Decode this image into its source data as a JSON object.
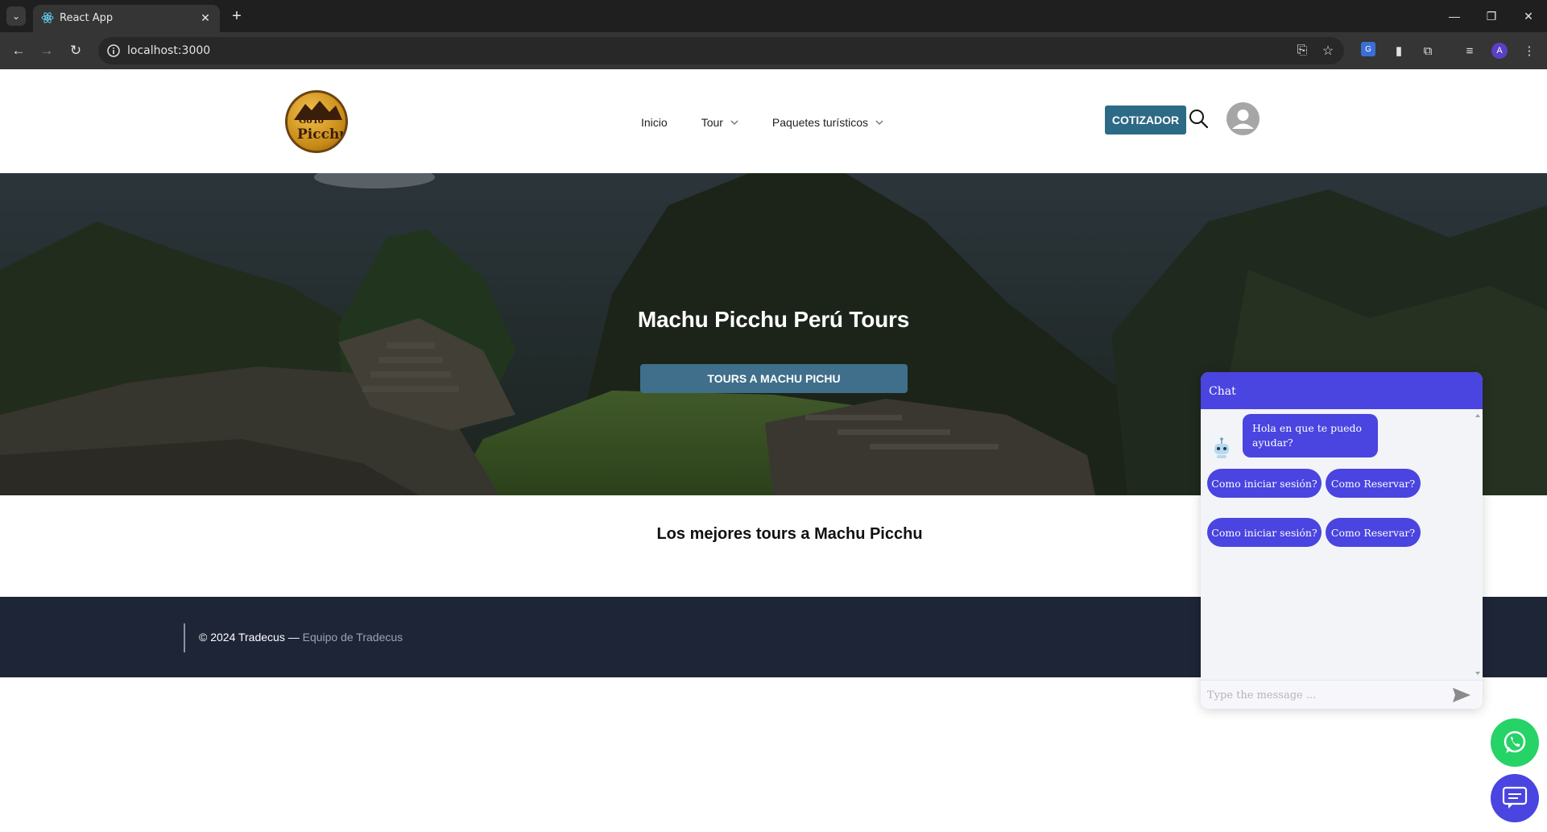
{
  "browser": {
    "tab_title": "React App",
    "url": "localhost:3000",
    "profile_initial": "A"
  },
  "header": {
    "logo_text_top": "GoTo",
    "logo_text_bottom": "Picchu",
    "nav": [
      {
        "label": "Inicio",
        "has_dropdown": false
      },
      {
        "label": "Tour",
        "has_dropdown": true
      },
      {
        "label": "Paquetes turísticos",
        "has_dropdown": true
      }
    ],
    "cta_label": "COTIZADOR",
    "accent_color": "#2d6a86"
  },
  "hero": {
    "title": "Machu Picchu Perú Tours",
    "button_label": "TOURS A MACHU PICHU"
  },
  "section": {
    "title": "Los mejores tours a Machu Picchu"
  },
  "footer": {
    "copyright": "© 2024 Tradecus —",
    "team": "Equipo de Tradecus"
  },
  "chat": {
    "title": "Chat",
    "bot_message": "Hola en que te puedo ayudar?",
    "quick_replies": [
      "Como iniciar sesión?",
      "Como Reservar?",
      "Como iniciar sesión?",
      "Como Reservar?"
    ],
    "input_placeholder": "Type the message ...",
    "brand_color": "#4a44e0"
  },
  "fabs": {
    "whatsapp_color": "#25d366"
  }
}
